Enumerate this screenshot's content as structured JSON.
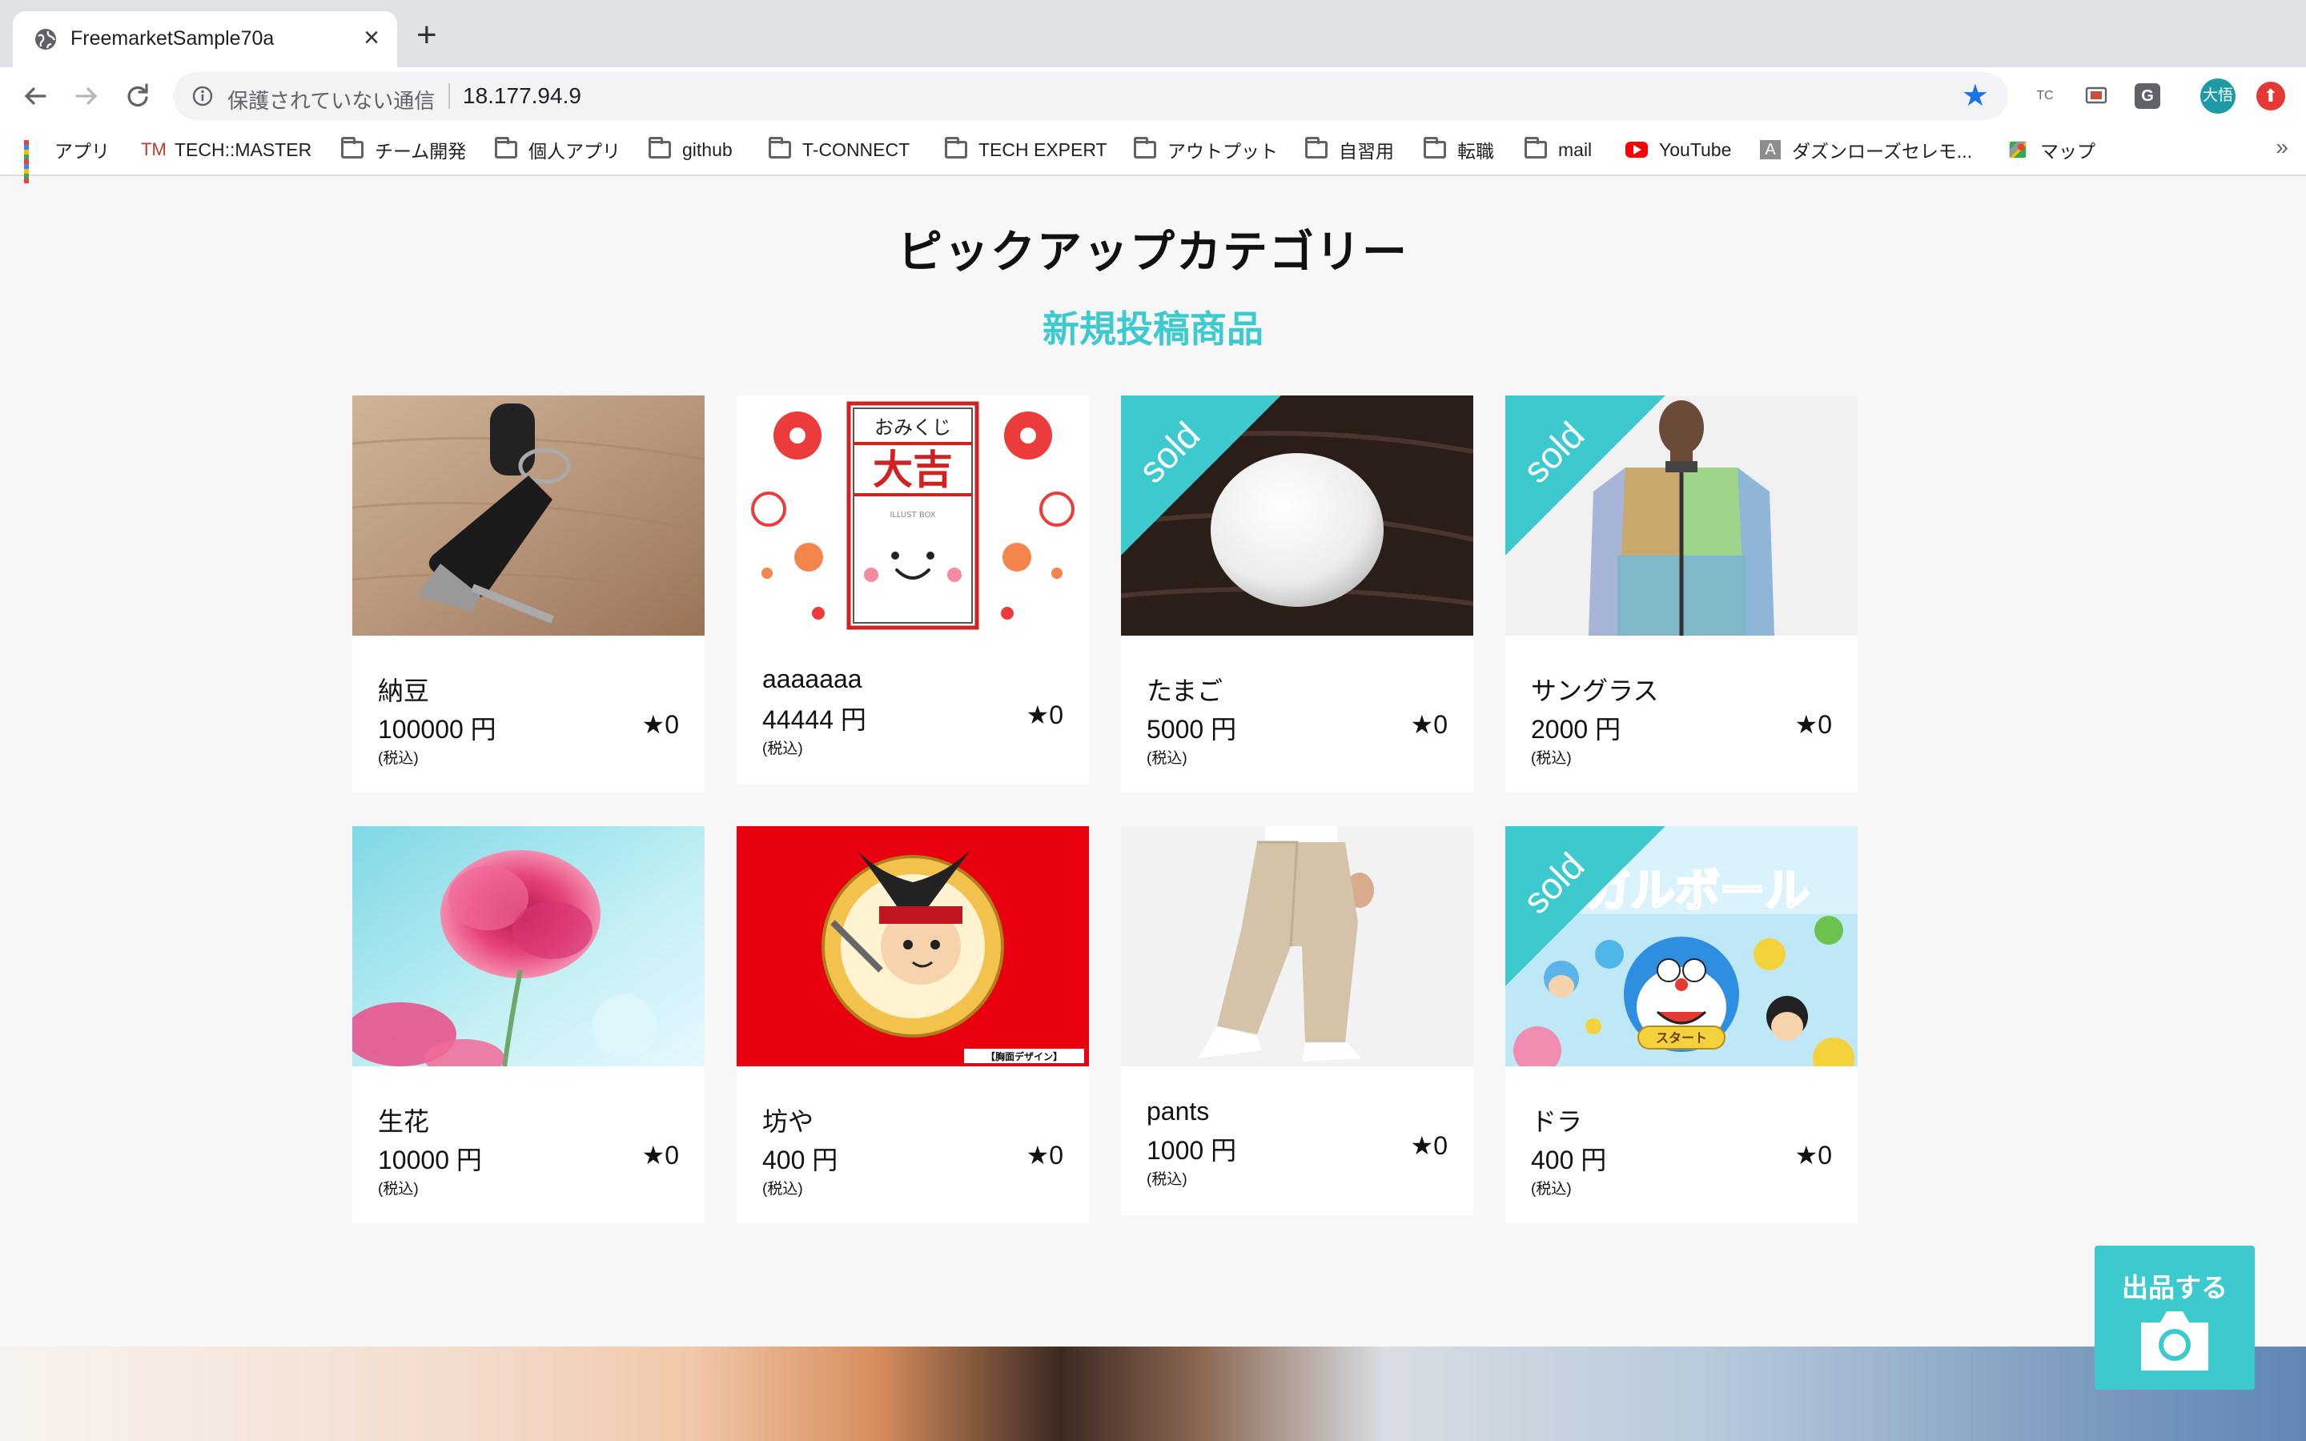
{
  "browser": {
    "tab_title": "FreemarketSample70a",
    "insecure_label": "保護されていない通信",
    "url": "18.177.94.9",
    "avatar_label": "大悟",
    "ext_tc": "TC",
    "ext_g": "G",
    "bookmarks": [
      {
        "label": "アプリ",
        "icon": "apps-grid-icon"
      },
      {
        "label": "TECH::MASTER",
        "icon": "techmaster-icon",
        "icon_text": "TM"
      },
      {
        "label": "チーム開発",
        "icon": "folder-icon"
      },
      {
        "label": "個人アプリ",
        "icon": "folder-icon"
      },
      {
        "label": "github",
        "icon": "folder-icon"
      },
      {
        "label": "T-CONNECT",
        "icon": "folder-icon"
      },
      {
        "label": "TECH EXPERT",
        "icon": "folder-icon"
      },
      {
        "label": "アウトプット",
        "icon": "folder-icon"
      },
      {
        "label": "自習用",
        "icon": "folder-icon"
      },
      {
        "label": "転職",
        "icon": "folder-icon"
      },
      {
        "label": "mail",
        "icon": "folder-icon"
      },
      {
        "label": "YouTube",
        "icon": "youtube-icon"
      },
      {
        "label": "ダズンローズセレモ...",
        "icon": "a-site-icon",
        "icon_text": "A"
      },
      {
        "label": "マップ",
        "icon": "maps-icon"
      }
    ],
    "more": "»"
  },
  "page": {
    "title": "ピックアップカテゴリー",
    "section": "新規投稿商品",
    "sell_button": "出品する",
    "products": [
      {
        "name": "納豆",
        "price": "100000 円",
        "tax": "(税込)",
        "likes": "★0",
        "sold": false,
        "image": "car-keys-photo"
      },
      {
        "name": "aaaaaaa",
        "price": "44444 円",
        "tax": "(税込)",
        "likes": "★0",
        "sold": false,
        "image": "omikuji-daikichi-illustration",
        "omikuji_top": "おみくじ",
        "omikuji_main": "大吉",
        "omikuji_sub": "ILLUST BOX"
      },
      {
        "name": "たまご",
        "price": "5000 円",
        "tax": "(税込)",
        "likes": "★0",
        "sold": true,
        "sold_label": "sold",
        "image": "egg-photo"
      },
      {
        "name": "サングラス",
        "price": "2000 円",
        "tax": "(税込)",
        "likes": "★0",
        "sold": true,
        "sold_label": "sold",
        "image": "jacket-model-photo"
      },
      {
        "name": "生花",
        "price": "10000 円",
        "tax": "(税込)",
        "likes": "★0",
        "sold": false,
        "image": "pink-flower-photo"
      },
      {
        "name": "坊や",
        "price": "400 円",
        "tax": "(税込)",
        "likes": "★0",
        "sold": false,
        "image": "carp-mascot-illustration",
        "badge": "【胸面デザイン】"
      },
      {
        "name": "pants",
        "price": "1000 円",
        "tax": "(税込)",
        "likes": "★0",
        "sold": false,
        "image": "pants-photo"
      },
      {
        "name": "ドラ",
        "price": "400 円",
        "tax": "(税込)",
        "likes": "★0",
        "sold": true,
        "sold_label": "sold",
        "image": "doraemon-game-image",
        "game_title": "ガルボール",
        "game_start": "スタート"
      }
    ]
  },
  "colors": {
    "accent": "#3ccace",
    "star": "#1a73e8"
  }
}
